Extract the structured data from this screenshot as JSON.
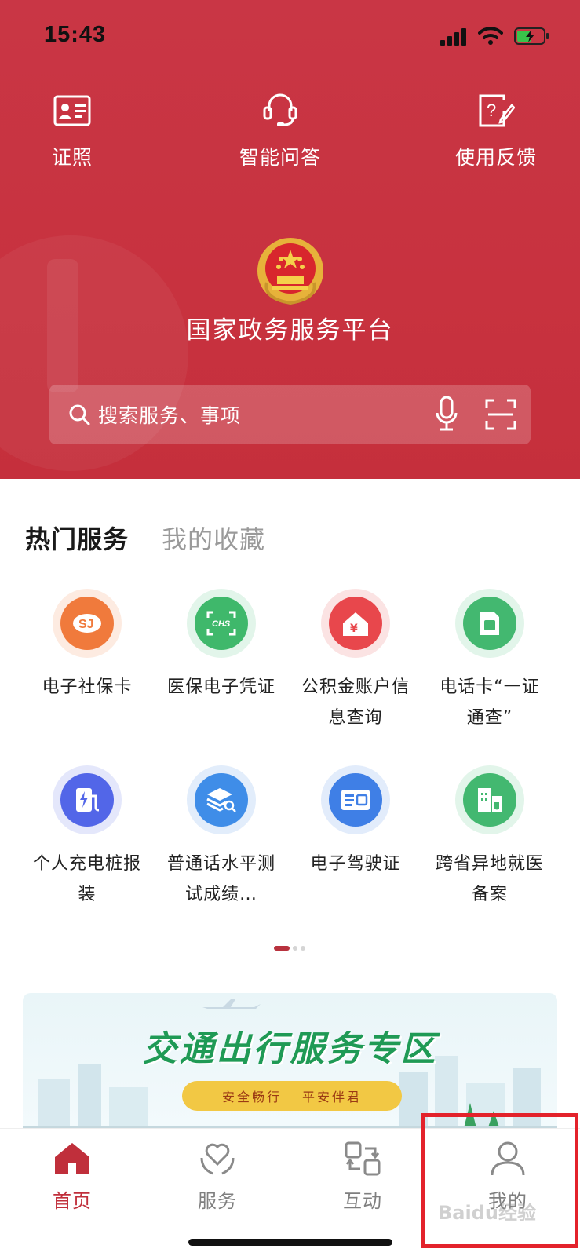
{
  "status_bar": {
    "time": "15:43",
    "signal_icon": "signal-bars-icon",
    "wifi_icon": "wifi-icon",
    "battery_icon": "battery-charging-icon"
  },
  "quick_actions": [
    {
      "label": "证照",
      "icon": "id-card-icon"
    },
    {
      "label": "智能问答",
      "icon": "headset-icon"
    },
    {
      "label": "使用反馈",
      "icon": "feedback-edit-icon"
    }
  ],
  "platform": {
    "title": "国家政务服务平台",
    "emblem_icon": "national-emblem-icon"
  },
  "search": {
    "placeholder": "搜索服务、事项",
    "mic_icon": "microphone-icon",
    "scan_icon": "scan-icon"
  },
  "section_tabs": {
    "active": "热门服务",
    "inactive": "我的收藏"
  },
  "services": [
    {
      "label": "电子社保卡",
      "icon": "social-security-icon",
      "color": "#f07a3c"
    },
    {
      "label": "医保电子凭证",
      "icon": "chs-medical-insurance-icon",
      "color": "#3fb86b"
    },
    {
      "label": "公积金账户信息查询",
      "icon": "housing-fund-icon",
      "color": "#e8474c"
    },
    {
      "label": "电话卡“一证通查”",
      "icon": "sim-card-icon",
      "color": "#43b870"
    },
    {
      "label": "个人充电桩报装",
      "icon": "charging-pile-icon",
      "color": "#5266e8"
    },
    {
      "label": "普通话水平测试成绩…",
      "icon": "layers-search-icon",
      "color": "#3f8de8"
    },
    {
      "label": "电子驾驶证",
      "icon": "driver-license-icon",
      "color": "#3f7fe6"
    },
    {
      "label": "跨省异地就医备案",
      "icon": "hospital-icon",
      "color": "#43b870"
    }
  ],
  "banner": {
    "title": "交通出行服务专区",
    "slogan_1": "安全畅行",
    "slogan_2": "平安伴君"
  },
  "bottom_nav": [
    {
      "label": "首页",
      "icon": "home-icon",
      "active": true
    },
    {
      "label": "服务",
      "icon": "heart-hands-icon",
      "active": false
    },
    {
      "label": "互动",
      "icon": "exchange-icon",
      "active": false
    },
    {
      "label": "我的",
      "icon": "user-icon",
      "active": false
    }
  ],
  "watermark": "Baidu经验",
  "colors": {
    "primary_red": "#c8323f",
    "active_tab": "#c02f3b",
    "highlight": "#e3222b"
  }
}
